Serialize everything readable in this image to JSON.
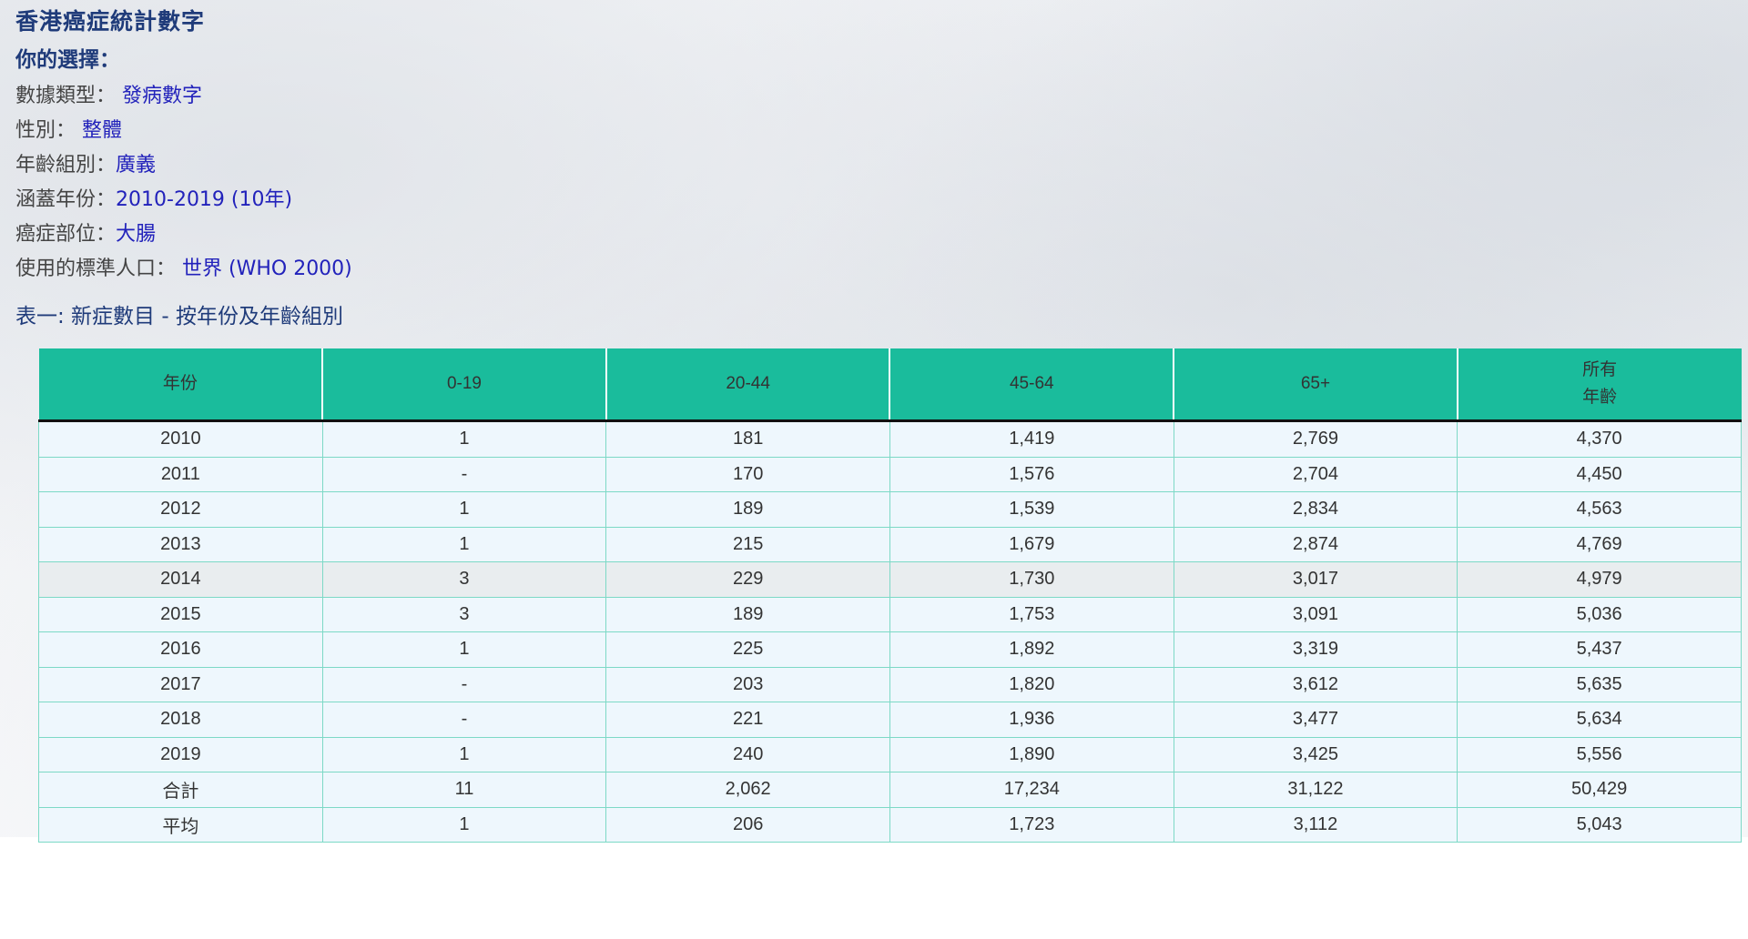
{
  "header": {
    "title": "香港癌症統計數字",
    "choice_title": "你的選擇："
  },
  "selections": [
    {
      "label": "數據類型：",
      "value": " 發病數字"
    },
    {
      "label": "性別：",
      "value": " 整體"
    },
    {
      "label": "年齡組別：",
      "value": "廣義"
    },
    {
      "label": "涵蓋年份：",
      "value": "2010-2019 (10年)"
    },
    {
      "label": "癌症部位：",
      "value": "大腸"
    },
    {
      "label": "使用的標準人口：",
      "value": " 世界 (WHO 2000)"
    }
  ],
  "table_title": "表一: 新症數目 - 按年份及年齡組別",
  "table": {
    "headers": [
      "年份",
      "0-19",
      "20-44",
      "45-64",
      "65+",
      "所有",
      "年齡"
    ],
    "rows": [
      [
        "2010",
        "1",
        "181",
        "1,419",
        "2,769",
        "4,370"
      ],
      [
        "2011",
        "-",
        "170",
        "1,576",
        "2,704",
        "4,450"
      ],
      [
        "2012",
        "1",
        "189",
        "1,539",
        "2,834",
        "4,563"
      ],
      [
        "2013",
        "1",
        "215",
        "1,679",
        "2,874",
        "4,769"
      ],
      [
        "2014",
        "3",
        "229",
        "1,730",
        "3,017",
        "4,979"
      ],
      [
        "2015",
        "3",
        "189",
        "1,753",
        "3,091",
        "5,036"
      ],
      [
        "2016",
        "1",
        "225",
        "1,892",
        "3,319",
        "5,437"
      ],
      [
        "2017",
        "-",
        "203",
        "1,820",
        "3,612",
        "5,635"
      ],
      [
        "2018",
        "-",
        "221",
        "1,936",
        "3,477",
        "5,634"
      ],
      [
        "2019",
        "1",
        "240",
        "1,890",
        "3,425",
        "5,556"
      ],
      [
        "合計",
        "11",
        "2,062",
        "17,234",
        "31,122",
        "50,429"
      ],
      [
        "平均",
        "1",
        "206",
        "1,723",
        "3,112",
        "5,043"
      ]
    ]
  },
  "colors": {
    "header_bg": "#1abc9c",
    "title": "#1f3b7a",
    "value_link": "#2222bb"
  }
}
